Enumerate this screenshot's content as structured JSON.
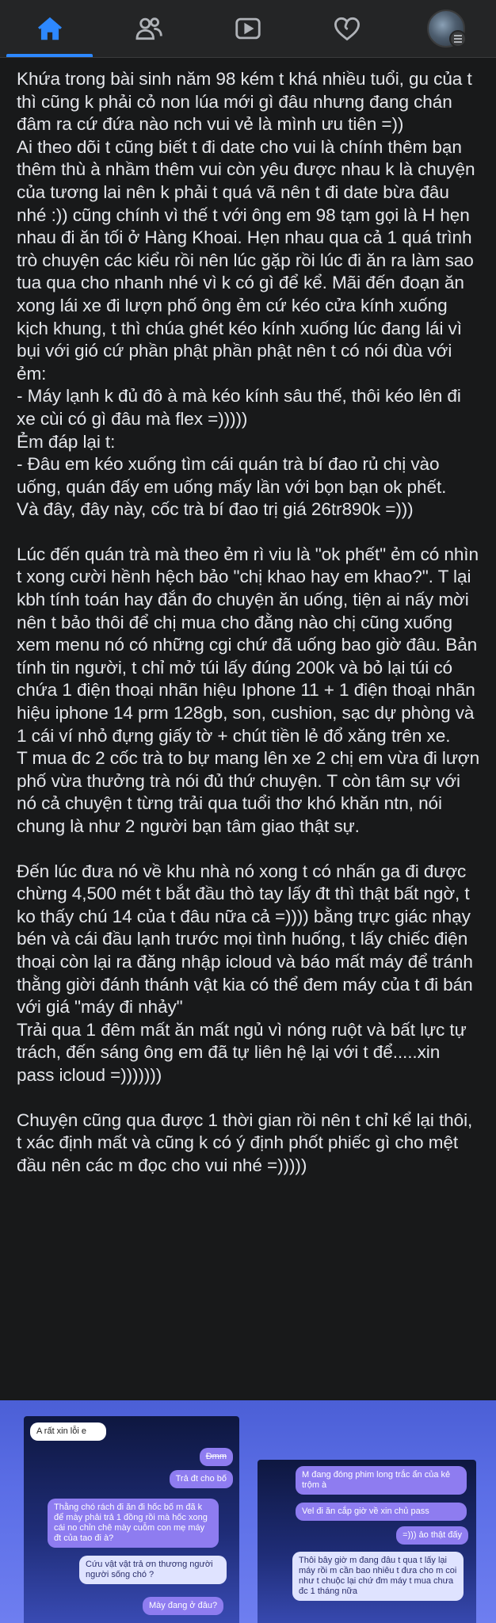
{
  "nav": {
    "items": [
      {
        "name": "home",
        "active": true
      },
      {
        "name": "friends",
        "active": false
      },
      {
        "name": "watch",
        "active": false
      },
      {
        "name": "dating",
        "active": false
      },
      {
        "name": "profile-menu",
        "active": false
      }
    ],
    "active_color": "#2d88ff",
    "icon_color": "#b0b3b8"
  },
  "post": {
    "paragraphs": [
      "Khứa trong bài sinh năm 98 kém t khá nhiều tuổi, gu của t thì cũng k phải cỏ non lúa mới gì đâu nhưng đang chán đâm ra cứ đứa nào nch vui vẻ là mình ưu tiên =))\nAi theo dõi t cũng biết t đi date cho vui là chính thêm bạn thêm thù à nhầm thêm vui còn yêu được nhau k là chuyện của tương lai nên k phải t quá vã nên t đi date bừa đâu nhé :)) cũng chính vì thế t với ông em 98 tạm gọi là H hẹn nhau đi ăn tối ở Hàng Khoai. Hẹn nhau qua cả 1 quá trình trò chuyện các kiểu rồi nên lúc gặp rồi lúc đi ăn ra làm sao tua qua cho nhanh nhé vì k có gì để kể. Mãi đến đoạn ăn xong lái xe đi lượn phố ông ẻm cứ kéo cửa kính xuống kịch khung, t thì chúa ghét kéo kính xuống lúc đang lái vì bụi với gió cứ phần phật phần phật nên t có nói đùa với ẻm:\n- Máy lạnh k đủ đô à mà kéo kính sâu thế, thôi kéo lên đi xe cùi có gì đâu mà flex =)))))\nẺm đáp lại t:\n- Đâu em kéo xuống tìm cái quán trà bí đao rủ chị vào uống, quán đấy em uống mấy lần với bọn bạn ok phết.\nVà đây, đây này, cốc trà bí đao trị giá 26tr890k =)))",
      "Lúc đến quán trà mà theo ẻm rì viu là \"ok phết\" ẻm có nhìn t xong cười hềnh hệch bảo \"chị khao hay em khao?\". T lại kbh tính toán hay đắn đo chuyện ăn uống, tiện ai nấy mời nên t bảo thôi để chị mua cho đằng nào chị cũng xuống xem menu nó có những cgi chứ đã uống bao giờ đâu. Bản tính tin người, t chỉ mở túi lấy đúng 200k và bỏ lại túi có chứa 1 điện thoại nhãn hiệu Iphone 11 + 1 điện thoại nhãn hiệu iphone 14 prm 128gb, son, cushion, sạc dự phòng và 1 cái ví nhỏ đựng giấy tờ + chút tiền lẻ đổ xăng trên xe.\nT mua đc 2 cốc trà to bự mang lên xe 2 chị em vừa đi lượn phố vừa thưởng trà nói đủ thứ chuyện. T còn tâm sự với nó cả chuyện t từng trải qua tuổi thơ khó khăn ntn, nói chung là như 2 người bạn tâm giao thật sự.",
      "Đến lúc đưa nó về khu nhà nó xong t có nhấn ga đi được chừng 4,500 mét t bắt đầu thò tay lấy đt thì thật bất ngờ, t ko thấy chú 14 của t đâu nữa cả =)))) bằng trực giác nhạy bén và cái đầu lạnh trước mọi tình huống, t lấy chiếc điện thoại còn lại ra đăng nhập icloud và báo mất máy để tránh thằng giời đánh thánh vật kia có thể đem máy của t đi bán với giá \"máy đi nhảy\"\nTrải qua 1 đêm mất ăn mất ngủ vì nóng ruột và bất lực tự trách, đến sáng ông em đã tự liên hệ lại với t để.....xin pass icloud =)))))))",
      "Chuyện cũng qua được 1 thời gian rồi nên t chỉ kể lại thôi, t xác định mất và cũng k có ý định phốt phiếc gì cho mệt đầu nên các m đọc cho vui nhé =)))))"
    ]
  },
  "chat_left": {
    "header": "A rất xin lỗi e",
    "m1": "Đmm",
    "m2": "Trả đt cho bố",
    "m3": "Thằng chó rách đi ăn đi hốc bố m đã k để mày phải trả 1 đồng rồi mà hốc xong cái no chỉn chê mày cuỗm con mẹ máy đt của tao đi à?",
    "m4": "Cứu vật vật trả ơn thương người người sống chó ?",
    "m5": "Mày đang ở đâu?"
  },
  "chat_right": {
    "m1": "M đang đóng phim long trắc ẩn của kẻ trộm à",
    "m2": "Vel đi ăn cắp giờ về xin chủ pass",
    "m3": "=))) ảo thật đấy",
    "m4": "Thôi bây giờ m đang đâu t qua t lấy lại máy rồi m cần bao nhiêu t đưa cho m coi như t chuộc lại chứ đm máy t mua chưa đc 1 tháng nữa"
  }
}
